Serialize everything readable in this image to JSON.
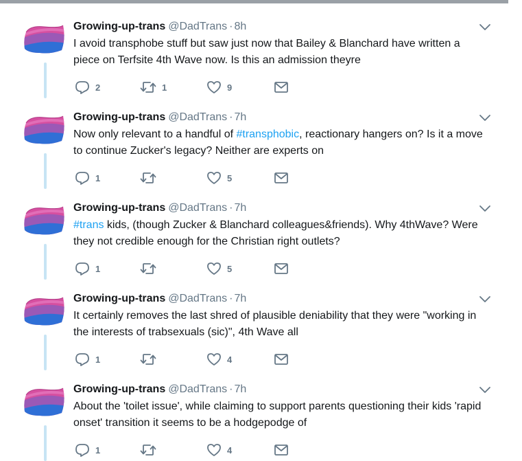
{
  "tweets": [
    {
      "name": "Growing-up-trans",
      "handle": "@DadTrans",
      "separator": "·",
      "time": "8h",
      "text_parts": [
        "I avoid transphobe stuff but saw just now that Bailey & Blanchard have written a piece on Terfsite 4th Wave now. Is this an admission theyre",
        "",
        ""
      ],
      "replies": "2",
      "retweets": "1",
      "likes": "9"
    },
    {
      "name": "Growing-up-trans",
      "handle": "@DadTrans",
      "separator": "·",
      "time": "7h",
      "text_parts": [
        "Now only relevant to a handful of ",
        "#transphobic",
        ", reactionary hangers on? Is it a move to continue Zucker's legacy? Neither are experts on"
      ],
      "replies": "1",
      "retweets": "",
      "likes": "5"
    },
    {
      "name": "Growing-up-trans",
      "handle": "@DadTrans",
      "separator": "·",
      "time": "7h",
      "text_parts": [
        "",
        "#trans",
        " kids, (though Zucker & Blanchard colleagues&friends). Why 4thWave? Were they not credible enough for the Christian right outlets?"
      ],
      "replies": "1",
      "retweets": "",
      "likes": "5"
    },
    {
      "name": "Growing-up-trans",
      "handle": "@DadTrans",
      "separator": "·",
      "time": "7h",
      "text_parts": [
        "It certainly removes the last shred of plausible deniability that they were \"working in the interests of trabsexuals (sic)\", 4th Wave all",
        "",
        ""
      ],
      "replies": "1",
      "retweets": "",
      "likes": "4"
    },
    {
      "name": "Growing-up-trans",
      "handle": "@DadTrans",
      "separator": "·",
      "time": "7h",
      "text_parts": [
        "About the 'toilet issue', while claiming to support parents questioning their kids 'rapid onset' transition it seems to be a hodgepodge of",
        "",
        ""
      ],
      "replies": "1",
      "retweets": "",
      "likes": "4"
    }
  ],
  "icons": {
    "avatar": "bi-flag-avatar",
    "caret": "chevron-down-icon",
    "reply": "reply-icon",
    "retweet": "retweet-icon",
    "like": "heart-icon",
    "dm": "envelope-icon"
  },
  "colors": {
    "hashtag": "#1da1f2",
    "thread_line": "#c7e4f4",
    "muted": "#657786",
    "avatar_pink": "#d64fa0",
    "avatar_purple": "#9b59b6",
    "avatar_blue": "#2f6fd6"
  }
}
